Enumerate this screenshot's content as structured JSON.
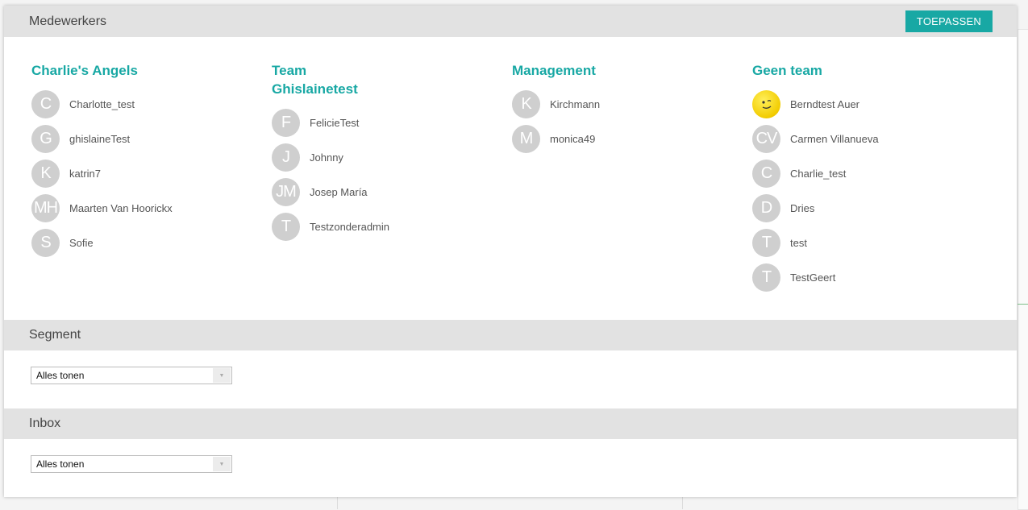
{
  "employees": {
    "title": "Medewerkers",
    "apply_label": "TOEPASSEN",
    "teams": [
      {
        "name": "Charlie's Angels",
        "members": [
          {
            "initials": "C",
            "name": "Charlotte_test"
          },
          {
            "initials": "G",
            "name": "ghislaineTest"
          },
          {
            "initials": "K",
            "name": "katrin7"
          },
          {
            "initials": "MH",
            "name": "Maarten Van Hoorickx"
          },
          {
            "initials": "S",
            "name": "Sofie"
          }
        ]
      },
      {
        "name": "Team Ghislainetest",
        "members": [
          {
            "initials": "F",
            "name": "FelicieTest"
          },
          {
            "initials": "J",
            "name": "Johnny"
          },
          {
            "initials": "JM",
            "name": "Josep María"
          },
          {
            "initials": "T",
            "name": "Testzonderadmin"
          }
        ]
      },
      {
        "name": "Management",
        "members": [
          {
            "initials": "K",
            "name": "Kirchmann"
          },
          {
            "initials": "M",
            "name": "monica49"
          }
        ]
      },
      {
        "name": "Geen team",
        "members": [
          {
            "initials": "",
            "name": "Berndtest Auer",
            "icon": "smiley-avatar-icon"
          },
          {
            "initials": "CV",
            "name": "Carmen Villanueva"
          },
          {
            "initials": "C",
            "name": "Charlie_test"
          },
          {
            "initials": "D",
            "name": "Dries"
          },
          {
            "initials": "T",
            "name": "test"
          },
          {
            "initials": "T",
            "name": "TestGeert"
          }
        ]
      }
    ]
  },
  "segment": {
    "title": "Segment",
    "selected": "Alles tonen",
    "arrow_icon": "chevron-down-icon"
  },
  "inbox": {
    "title": "Inbox",
    "selected": "Alles tonen",
    "arrow_icon": "chevron-down-icon"
  },
  "colors": {
    "accent": "#18a8a4",
    "header_bg": "#e2e2e2",
    "avatar_bg": "#cfcfcf"
  }
}
